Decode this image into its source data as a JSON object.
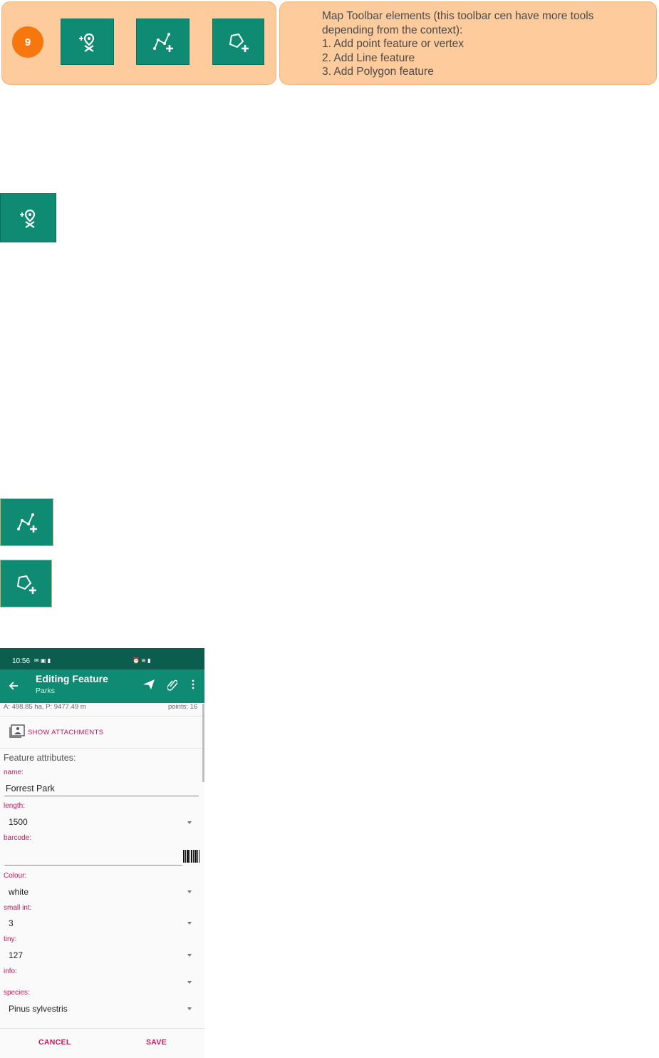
{
  "banner": {
    "badge_number": "9",
    "description_lines": [
      "Map Toolbar elements (this toolbar cen have more tools",
      "depending from the context):",
      "1. Add point feature or vertex",
      "2. Add Line feature",
      "3. Add Polygon feature"
    ]
  },
  "icons": {
    "point": "add-point-icon",
    "line": "add-line-icon",
    "polygon": "add-polygon-icon"
  },
  "phone": {
    "status_time": "10:56",
    "title": "Editing Feature",
    "subtitle": "Parks",
    "measure": "A: 498.85 ha, P: 9477.49 m",
    "points": "points: 16",
    "show_attachments": "SHOW ATTACHMENTS",
    "section_title": "Feature attributes:",
    "fields": {
      "name_label": "name:",
      "name_value": "Forrest Park",
      "length_label": "length:",
      "length_value": "1500",
      "barcode_label": "barcode:",
      "colour_label": "Colour:",
      "colour_value": "white",
      "smallint_label": "small int:",
      "smallint_value": "3",
      "tiny_label": "tiny:",
      "tiny_value": "127",
      "info_label": "info:",
      "species_label": "species:",
      "species_value": "Pinus sylvestris"
    },
    "cancel_label": "CANCEL",
    "save_label": "SAVE",
    "colors": {
      "primary": "#0f8a73",
      "primary_dark": "#0b5e4d",
      "accent": "#c2185b"
    }
  },
  "colors": {
    "banner_bg": "#fdcb9c",
    "badge": "#f6770e",
    "tool_bg": "#0f8a73"
  }
}
